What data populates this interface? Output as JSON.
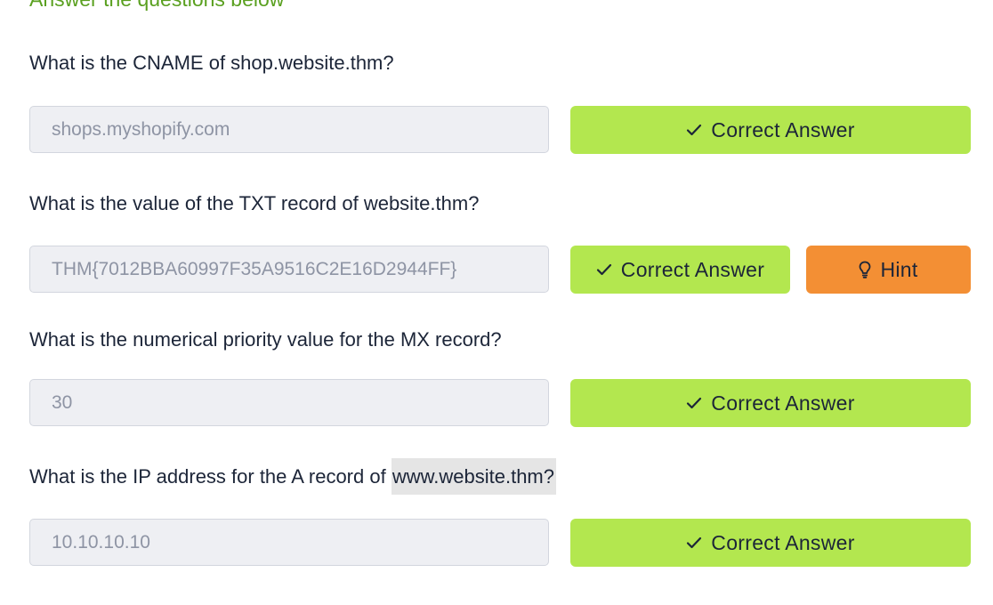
{
  "section": {
    "heading": "Answer the questions below"
  },
  "questions": [
    {
      "text": "What is the CNAME of shop.website.thm?",
      "answer": "shops.myshopify.com",
      "button_label": "Correct Answer"
    },
    {
      "text": "What is the value of the TXT record of website.thm?",
      "answer": "THM{7012BBA60997F35A9516C2E16D2944FF}",
      "button_label": "Correct Answer",
      "hint_label": "Hint"
    },
    {
      "text": "What is the numerical priority value for the MX record?",
      "answer": "30",
      "button_label": "Correct Answer"
    },
    {
      "text_prefix": "What is the IP address for the A record of ",
      "text_highlight": "www.website.thm?",
      "answer": "10.10.10.10",
      "button_label": "Correct Answer"
    }
  ],
  "colors": {
    "heading": "#5aa020",
    "correct_button": "#b3e74f",
    "hint_button": "#f38f34",
    "input_background": "#eeeff3"
  },
  "icons": {
    "correct": "check-icon",
    "hint": "lightbulb-icon"
  }
}
